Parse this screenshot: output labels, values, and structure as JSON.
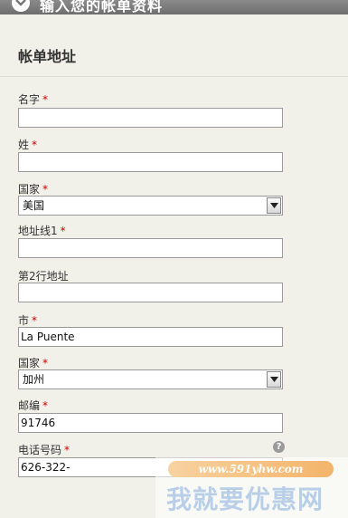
{
  "header": {
    "title": "输入您的帐单资料"
  },
  "section": {
    "title": "帐单地址"
  },
  "form": {
    "first_name": {
      "label": "名字",
      "value": ""
    },
    "last_name": {
      "label": "姓",
      "value": ""
    },
    "country": {
      "label": "国家",
      "value": "美国"
    },
    "address1": {
      "label": "地址线1",
      "value": ""
    },
    "address2": {
      "label": "第2行地址",
      "value": ""
    },
    "city": {
      "label": "市",
      "value": "La Puente"
    },
    "state": {
      "label": "国家",
      "value": "加州"
    },
    "zip": {
      "label": "邮编",
      "value": "91746"
    },
    "phone": {
      "label": "电话号码",
      "value": "626-322-"
    }
  },
  "help": {
    "glyph": "?"
  },
  "watermark": {
    "url": "www.591yhw.com",
    "text": "我就要优惠网"
  },
  "colors": {
    "required": "#cc0000",
    "header_bg": "#7a7a7a",
    "page_bg": "#f1f1ea"
  }
}
